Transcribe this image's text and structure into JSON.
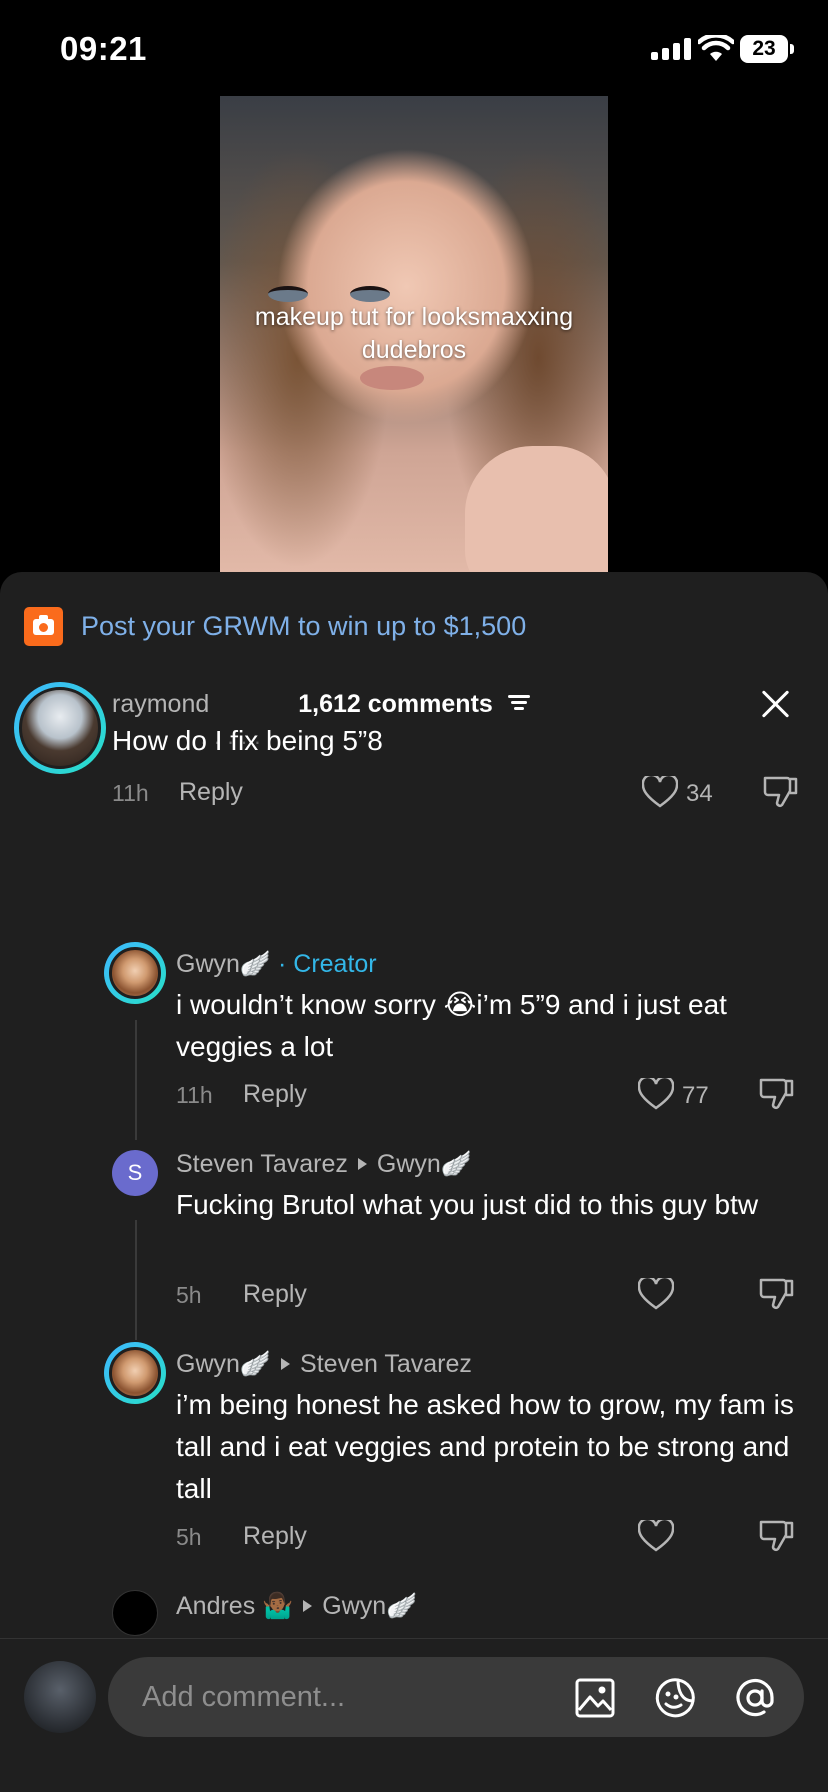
{
  "status": {
    "time": "09:21",
    "battery": "23"
  },
  "video": {
    "caption": "makeup tut for looksmaxxing dudebros"
  },
  "promo": {
    "text": "Post your GRWM to win up to $1,500"
  },
  "comments_header": {
    "count_label": "1,612 comments"
  },
  "comments": [
    {
      "user": "raymond",
      "text": "How do I fix being 5”8",
      "time": "11h",
      "reply_label": "Reply",
      "likes": "34"
    },
    {
      "user": "Gwyn🪽",
      "creator_label": "· Creator",
      "text": "i wouldn’t know sorry 😭i’m 5”9 and i just eat veggies a lot",
      "time": "11h",
      "reply_label": "Reply",
      "likes": "77"
    },
    {
      "user": "Steven Tavarez",
      "reply_to": "Gwyn🪽",
      "avatar_letter": "S",
      "text": "Fucking Brutol what you just did to this guy btw",
      "time": "5h",
      "reply_label": "Reply"
    },
    {
      "user": "Gwyn🪽",
      "reply_to": "Steven Tavarez",
      "text": "i’m being honest he asked how to grow, my fam is tall and i eat veggies and protein to be strong and tall",
      "time": "5h",
      "reply_label": "Reply"
    },
    {
      "user": "Andres 🤷🏾‍♂️",
      "reply_to": "Gwyn🪽"
    }
  ],
  "composer": {
    "placeholder": "Add comment..."
  },
  "colors": {
    "accent_link": "#7fb0e8",
    "creator": "#33b7e8",
    "promo_icon": "#fa6b1c",
    "ring": "#27e0c7"
  },
  "icons": [
    "camera-icon",
    "filter-icon",
    "close-icon",
    "heart-icon",
    "dislike-icon",
    "image-icon",
    "sticker-icon",
    "mention-icon"
  ]
}
